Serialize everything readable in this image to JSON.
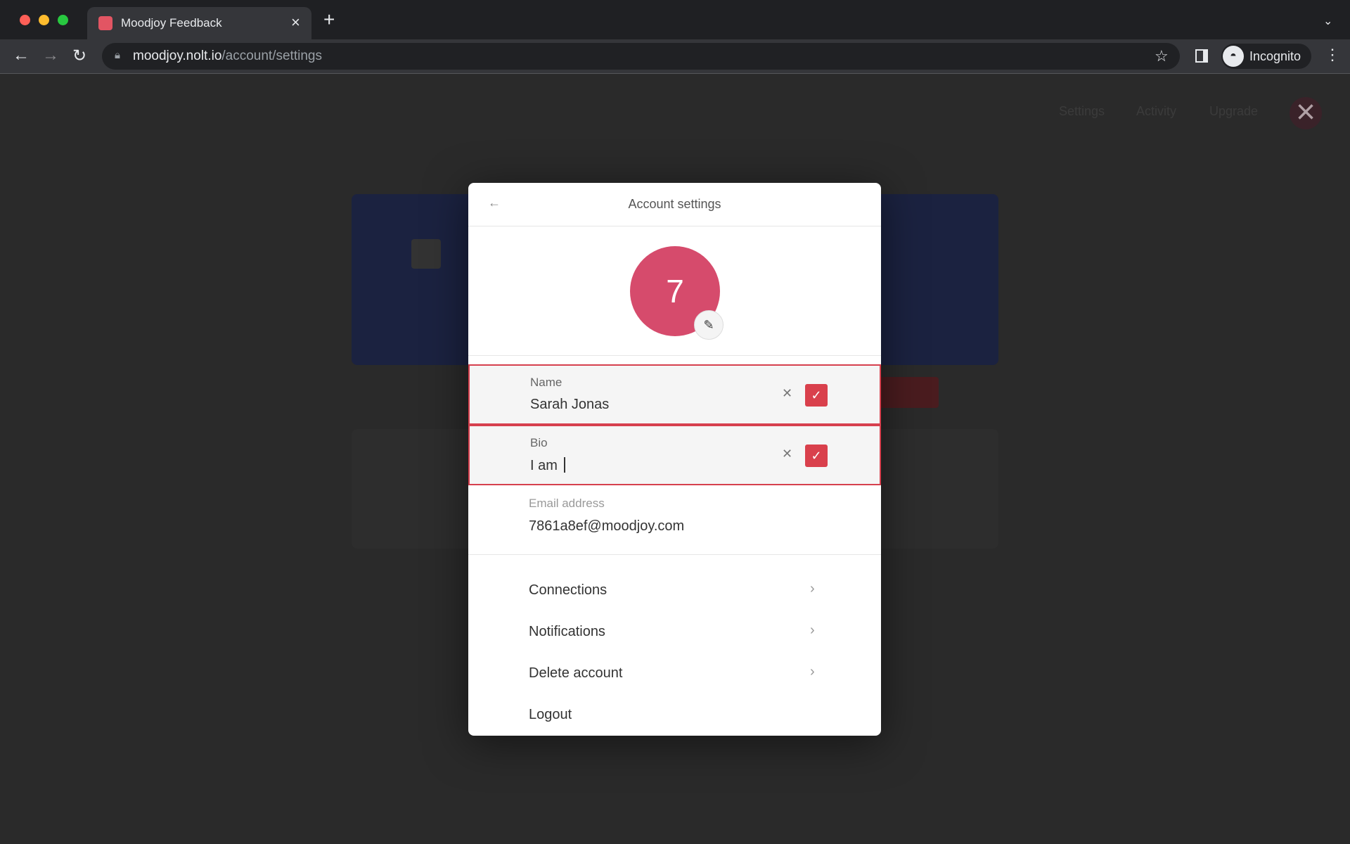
{
  "browser": {
    "tab_title": "Moodjoy Feedback",
    "url_domain": "moodjoy.nolt.io",
    "url_path": "/account/settings",
    "profile_label": "Incognito"
  },
  "page": {
    "nav": [
      "Settings",
      "Activity",
      "Upgrade"
    ]
  },
  "modal": {
    "title": "Account settings",
    "avatar_initial": "7",
    "name": {
      "label": "Name",
      "value": "Sarah Jonas"
    },
    "bio": {
      "label": "Bio",
      "value": "I am "
    },
    "email": {
      "label": "Email address",
      "value": "7861a8ef@moodjoy.com"
    },
    "menu": [
      {
        "label": "Connections"
      },
      {
        "label": "Notifications"
      },
      {
        "label": "Delete account"
      },
      {
        "label": "Logout"
      }
    ]
  },
  "colors": {
    "accent": "#d9404c",
    "avatar": "#d64b6c"
  }
}
